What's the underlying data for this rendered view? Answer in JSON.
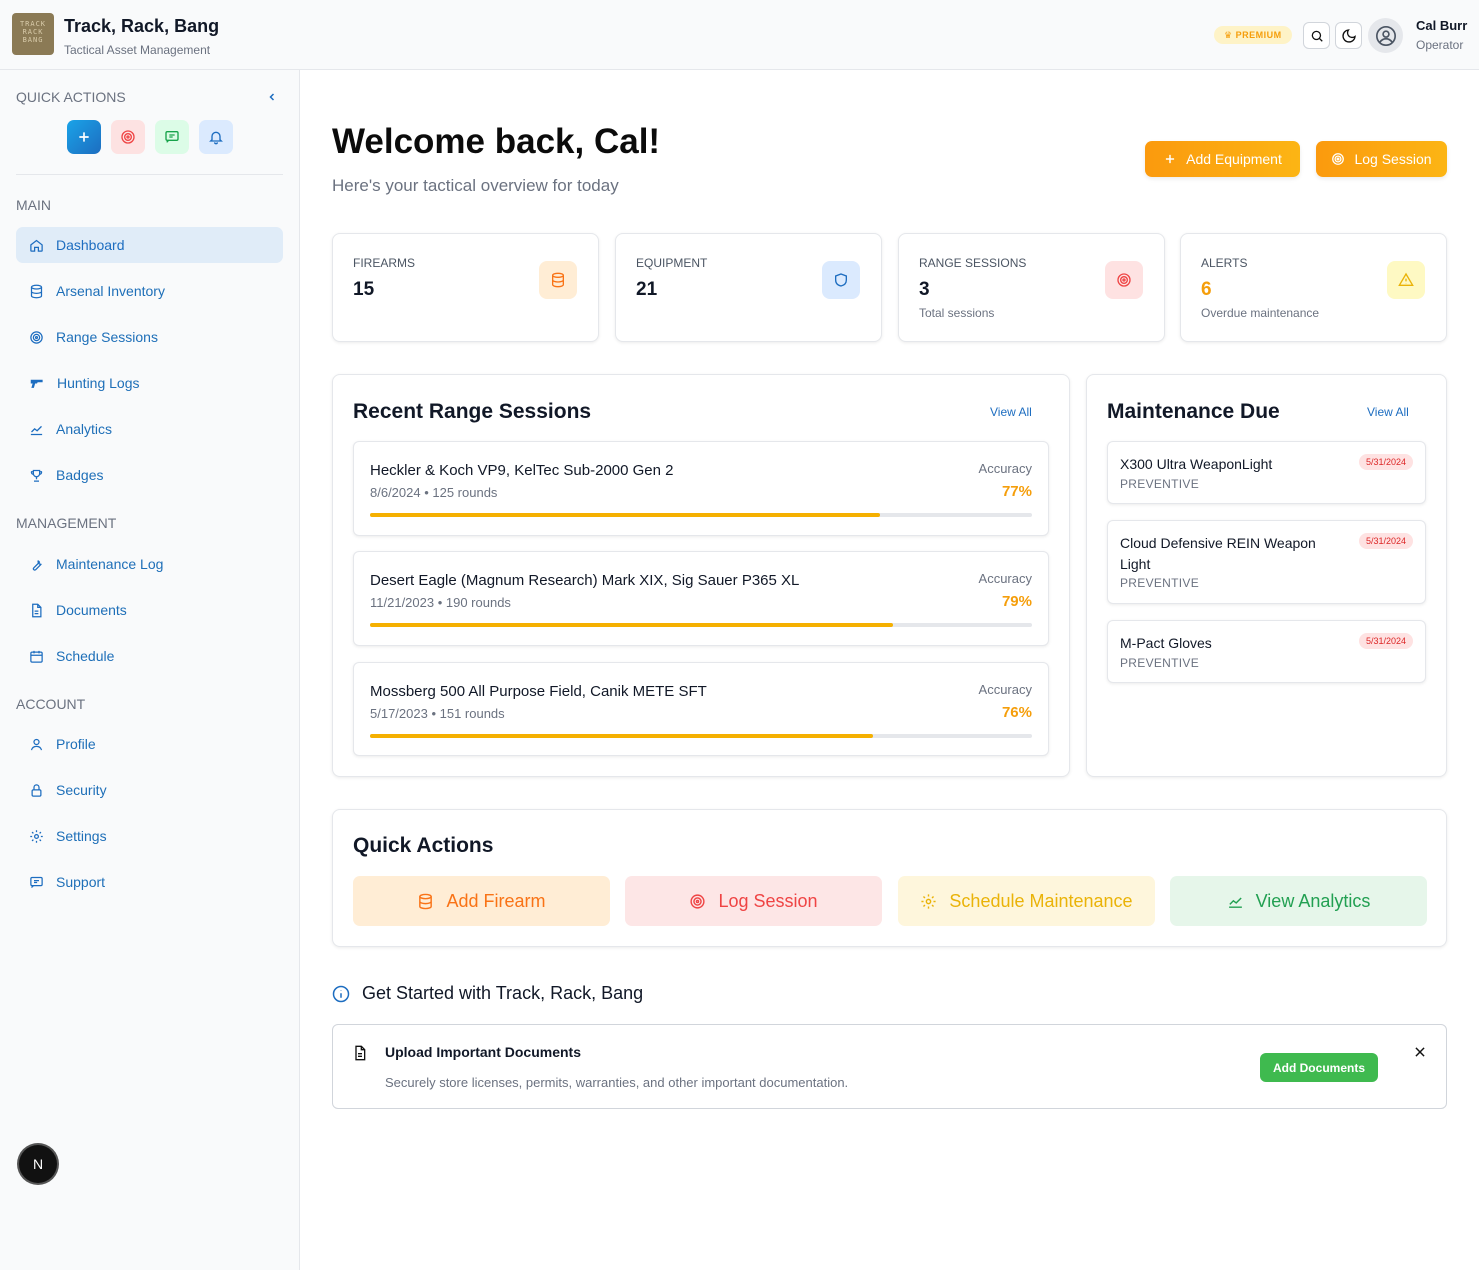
{
  "header": {
    "logo_text": "TRACK RACK BANG",
    "app_title": "Track, Rack, Bang",
    "app_subtitle": "Tactical Asset Management",
    "premium_label": "PREMIUM",
    "user_name": "Cal Burr",
    "user_role": "Operator"
  },
  "sidebar": {
    "quick_actions_title": "QUICK ACTIONS",
    "sections": {
      "main": "MAIN",
      "management": "MANAGEMENT",
      "account": "ACCOUNT"
    },
    "items": [
      {
        "label": "Dashboard",
        "icon": "home-icon"
      },
      {
        "label": "Arsenal Inventory",
        "icon": "database-icon"
      },
      {
        "label": "Range Sessions",
        "icon": "target-icon"
      },
      {
        "label": "Hunting Logs",
        "icon": "gun-icon"
      },
      {
        "label": "Analytics",
        "icon": "chart-line-icon"
      },
      {
        "label": "Badges",
        "icon": "trophy-icon"
      },
      {
        "label": "Maintenance Log",
        "icon": "wrench-icon"
      },
      {
        "label": "Documents",
        "icon": "document-icon"
      },
      {
        "label": "Schedule",
        "icon": "calendar-icon"
      },
      {
        "label": "Profile",
        "icon": "user-icon"
      },
      {
        "label": "Security",
        "icon": "lock-icon"
      },
      {
        "label": "Settings",
        "icon": "gear-icon"
      },
      {
        "label": "Support",
        "icon": "chat-icon"
      }
    ],
    "n_badge": "N"
  },
  "main": {
    "welcome": "Welcome back, Cal!",
    "welcome_sub": "Here's your tactical overview for today",
    "add_equipment": "Add Equipment",
    "log_session": "Log Session",
    "stats": [
      {
        "label": "FIREARMS",
        "value": "15",
        "note": ""
      },
      {
        "label": "EQUIPMENT",
        "value": "21",
        "note": ""
      },
      {
        "label": "RANGE SESSIONS",
        "value": "3",
        "note": "Total sessions"
      },
      {
        "label": "ALERTS",
        "value": "6",
        "note": "Overdue maintenance"
      }
    ],
    "recent": {
      "title": "Recent Range Sessions",
      "view_all": "View All",
      "accuracy_label": "Accuracy",
      "sessions": [
        {
          "name": "Heckler & Koch VP9, KelTec Sub-2000 Gen 2",
          "meta": "8/6/2024 • 125 rounds",
          "accuracy": "77%",
          "accuracy_value": 0.77
        },
        {
          "name": "Desert Eagle (Magnum Research) Mark XIX, Sig Sauer P365 XL",
          "meta": "11/21/2023 • 190 rounds",
          "accuracy": "79%",
          "accuracy_value": 0.79
        },
        {
          "name": "Mossberg 500 All Purpose Field, Canik METE SFT",
          "meta": "5/17/2023 • 151 rounds",
          "accuracy": "76%",
          "accuracy_value": 0.76
        }
      ]
    },
    "maintenance": {
      "title": "Maintenance Due",
      "view_all": "View All",
      "items": [
        {
          "name": "X300 Ultra WeaponLight",
          "type": "PREVENTIVE",
          "date": "5/31/2024"
        },
        {
          "name": "Cloud Defensive REIN Weapon Light",
          "type": "PREVENTIVE",
          "date": "5/31/2024"
        },
        {
          "name": "M-Pact Gloves",
          "type": "PREVENTIVE",
          "date": "5/31/2024"
        }
      ]
    },
    "quick_actions": {
      "title": "Quick Actions",
      "buttons": [
        "Add Firearm",
        "Log Session",
        "Schedule Maintenance",
        "View Analytics"
      ]
    },
    "get_started": {
      "title": "Get Started with Track, Rack, Bang",
      "doc_title": "Upload Important Documents",
      "doc_desc": "Securely store licenses, permits, warranties, and other important documentation.",
      "doc_button": "Add Documents"
    }
  },
  "colors": {
    "accent_blue": "#1d6dc0",
    "accent_orange": "#f59e0b",
    "success_green": "#3fba4f",
    "danger_red": "#dc2626"
  }
}
